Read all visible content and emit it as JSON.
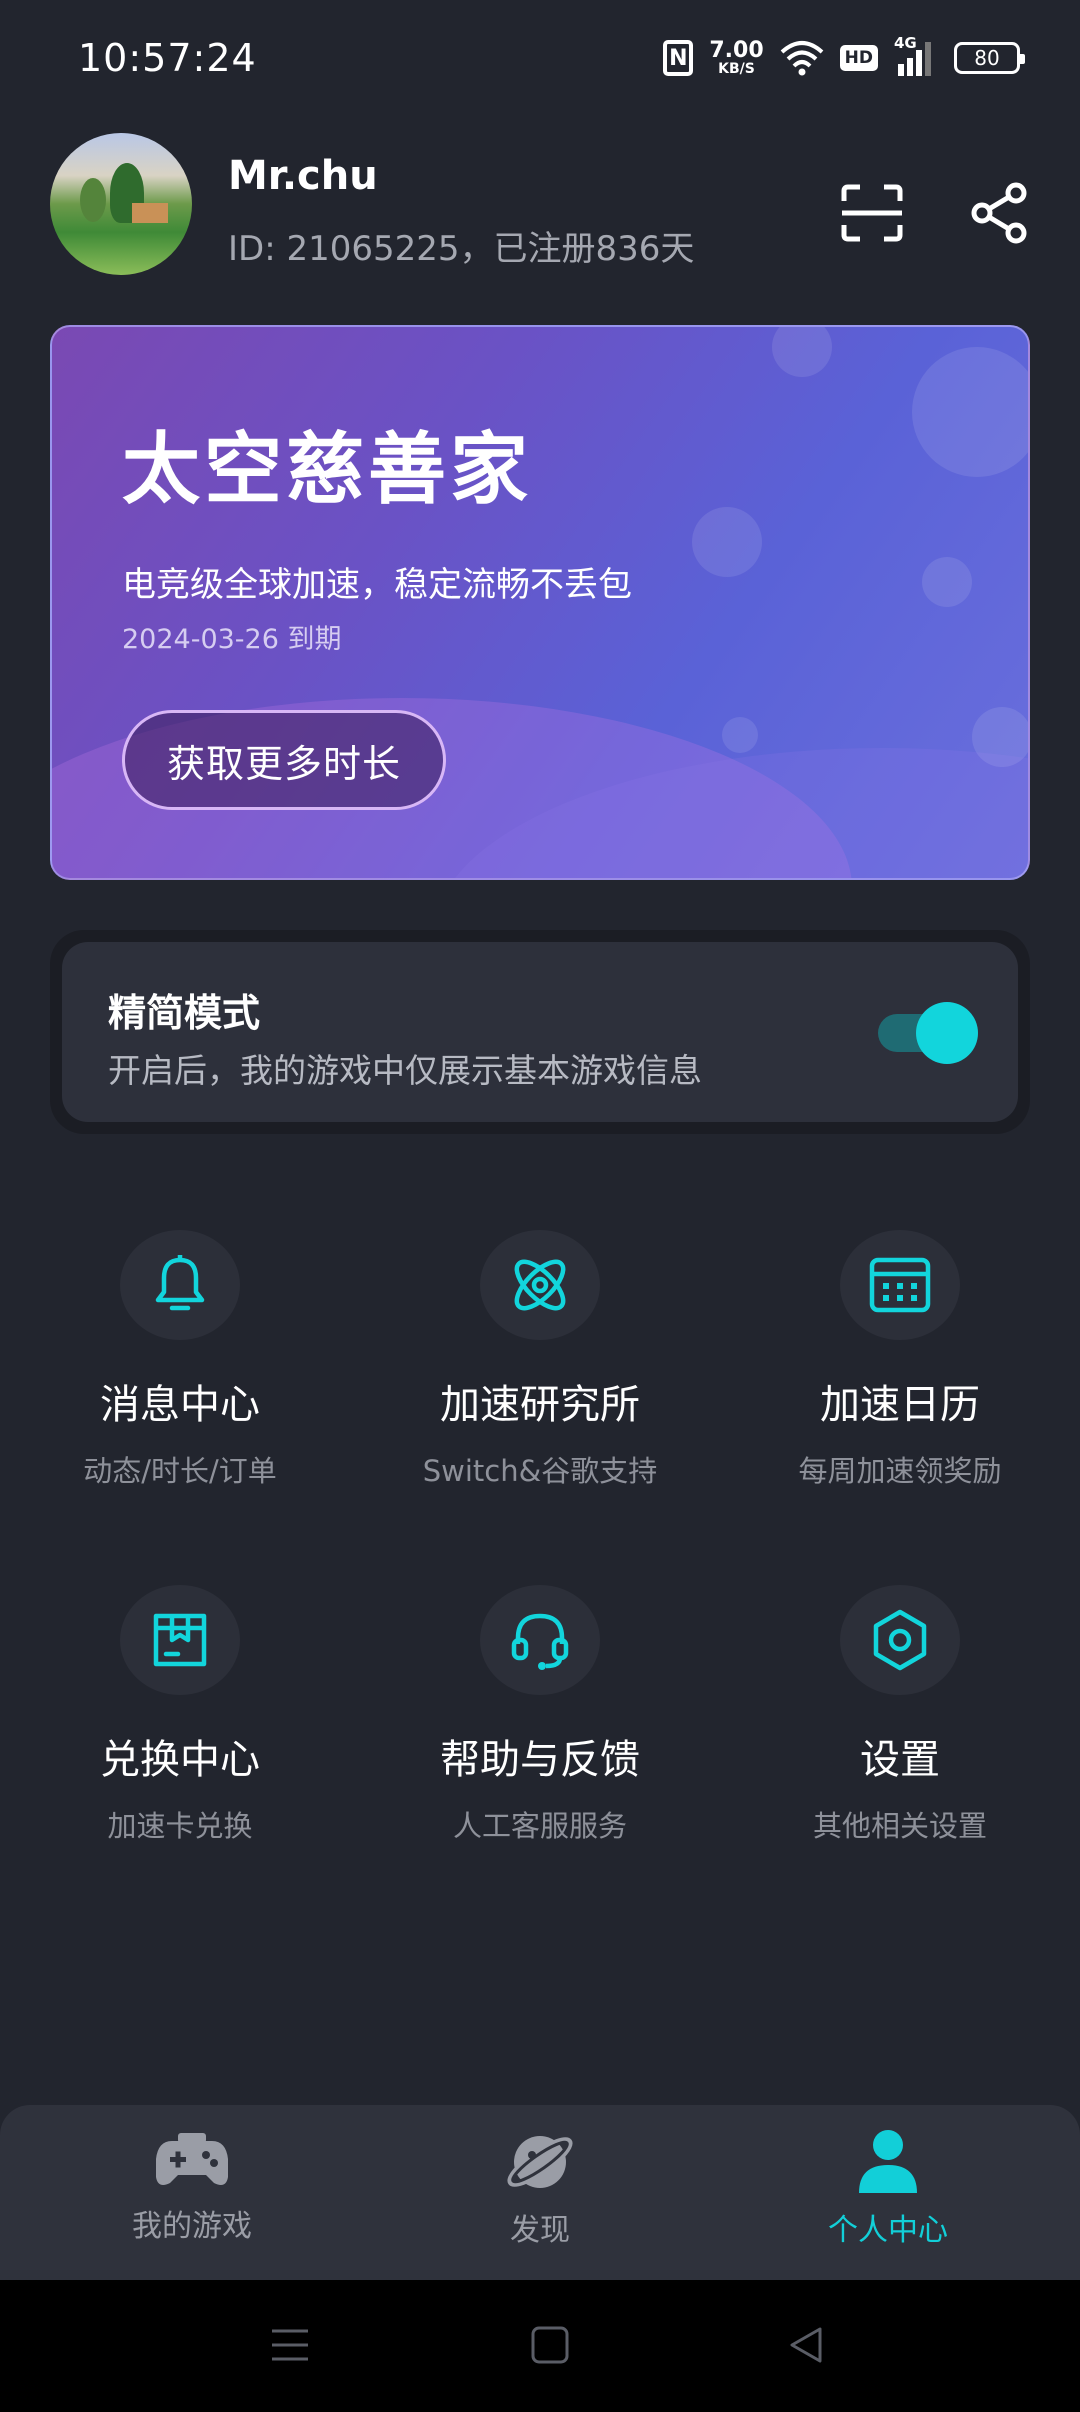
{
  "status_bar": {
    "time": "10:57:24",
    "nfc": "N",
    "net_speed_value": "7.00",
    "net_speed_unit": "KB/S",
    "hd": "HD",
    "network": "4G",
    "battery": "80"
  },
  "profile": {
    "username": "Mr.chu",
    "id_text": "ID: 21065225，已注册836天"
  },
  "vip_card": {
    "title": "太空慈善家",
    "description": "电竞级全球加速，稳定流畅不丢包",
    "expire": "2024-03-26 到期",
    "button_label": "获取更多时长"
  },
  "simple_mode": {
    "title": "精简模式",
    "description": "开启后，我的游戏中仅展示基本游戏信息",
    "enabled": true
  },
  "menu": [
    {
      "label": "消息中心",
      "sub": "动态/时长/订单",
      "icon": "bell-icon"
    },
    {
      "label": "加速研究所",
      "sub": "Switch&谷歌支持",
      "icon": "atom-icon"
    },
    {
      "label": "加速日历",
      "sub": "每周加速领奖励",
      "icon": "calendar-icon"
    },
    {
      "label": "兑换中心",
      "sub": "加速卡兑换",
      "icon": "gift-box-icon"
    },
    {
      "label": "帮助与反馈",
      "sub": "人工客服服务",
      "icon": "headset-icon"
    },
    {
      "label": "设置",
      "sub": "其他相关设置",
      "icon": "hexagon-settings-icon"
    }
  ],
  "bottom_nav": [
    {
      "label": "我的游戏",
      "icon": "gamepad-icon",
      "active": false
    },
    {
      "label": "发现",
      "icon": "planet-icon",
      "active": false
    },
    {
      "label": "个人中心",
      "icon": "person-icon",
      "active": true
    }
  ],
  "colors": {
    "background": "#22252e",
    "accent": "#12d5dc",
    "card_gradient_start": "#7a49b3",
    "card_gradient_end": "#6a6fdd"
  }
}
